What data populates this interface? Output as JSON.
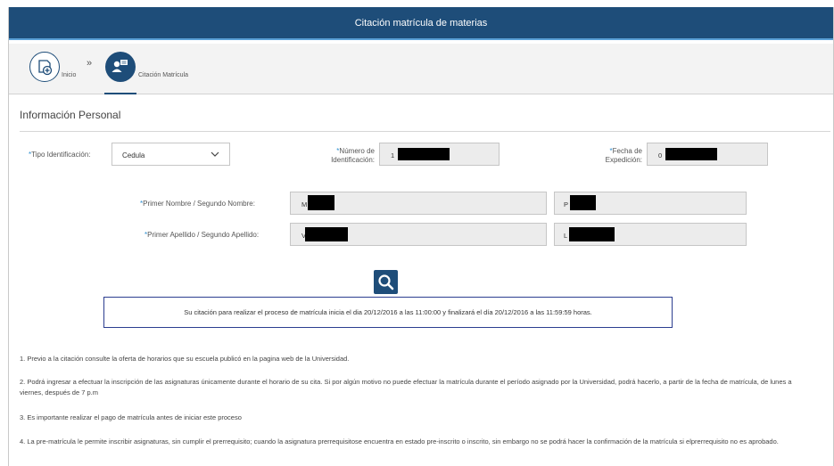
{
  "header": {
    "title": "Citación matrícula de materias"
  },
  "steps": [
    {
      "label": "Inicio",
      "icon": "add-document-icon"
    },
    {
      "label": "Citación Matrícula",
      "icon": "student-card-icon"
    }
  ],
  "section": {
    "title": "Información Personal"
  },
  "form": {
    "tipo_identificacion": {
      "label": "Tipo Identificación:",
      "value": "Cedula"
    },
    "numero_identificacion": {
      "label_line1": "Número de",
      "label_line2": "Identificación:",
      "value": "1"
    },
    "fecha_expedicion": {
      "label_line1": "Fecha de",
      "label_line2": "Expedición:",
      "value": "0"
    },
    "nombres": {
      "label": "Primer Nombre / Segundo Nombre:",
      "primer": "M",
      "segundo": "P"
    },
    "apellidos": {
      "label": "Primer Apellido / Segundo Apellido:",
      "primer": "V",
      "segundo": "L"
    },
    "required_mark": "*"
  },
  "notice": "Su citación para realizar el proceso de matrícula inicia el dia 20/12/2016 a las 11:00:00 y finalizará el día 20/12/2016 a las 11:59:59 horas.",
  "notes": [
    "1. Previo a la citación consulte la oferta de horarios que su escuela publicó en la pagina web de la Universidad.",
    "2. Podrá ingresar a efectuar la inscripción de las asignaturas únicamente durante el horario de su cita. Si por algún motivo no puede efectuar la matrícula durante el período asignado por la Universidad, podrá hacerlo, a partir de la fecha de matrícula, de lunes a viernes, después de 7 p.m",
    "3. Es importante realizar el pago de matrícula antes de iniciar este proceso",
    "4. La pre-matrícula le permite inscribir asignaturas, sin cumplir el prerrequisito; cuando la asignatura prerrequisitose encuentra en estado pre-inscrito o inscrito, sin embargo no se podrá hacer la confirmación de la matrícula si elprerrequisito no es aprobado."
  ],
  "colors": {
    "primary": "#1e4d79",
    "accent_line": "#5aa0d6",
    "required": "#2f8fd0",
    "notice_border": "#2c3e90"
  }
}
